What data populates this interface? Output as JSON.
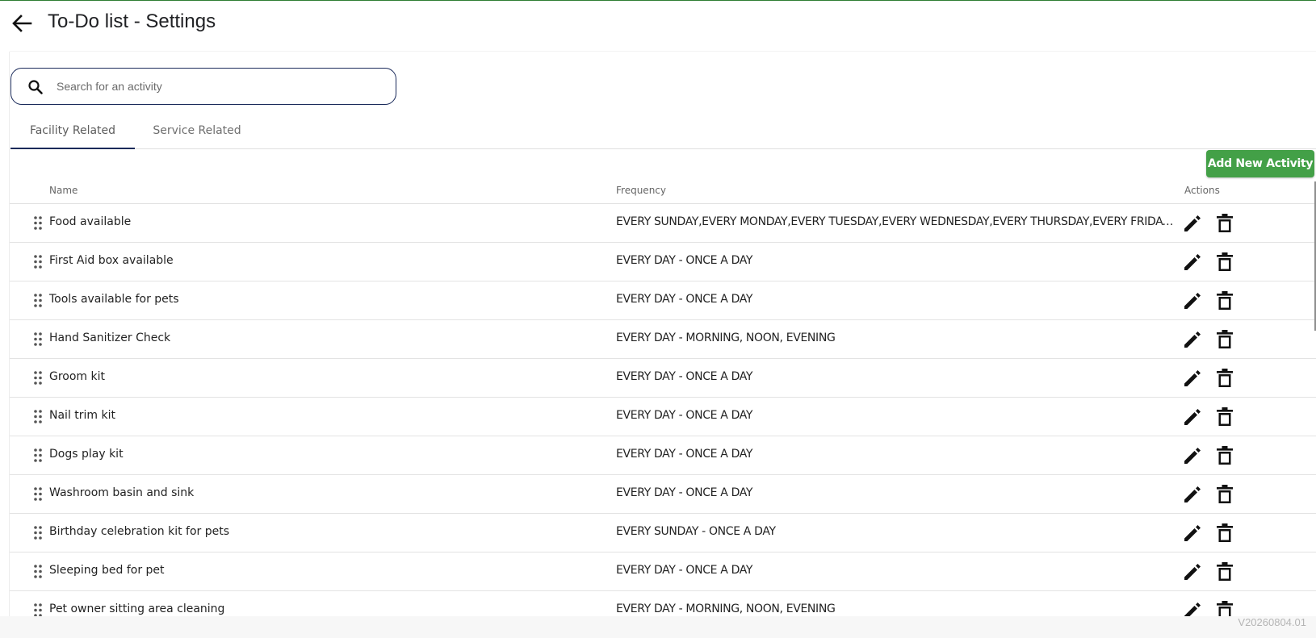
{
  "header": {
    "title": "To-Do list - Settings"
  },
  "search": {
    "placeholder": "Search for an activity",
    "value": ""
  },
  "tabs": [
    {
      "label": "Facility Related",
      "active": true
    },
    {
      "label": "Service Related",
      "active": false
    }
  ],
  "toolbar": {
    "add_label": "Add New Activity"
  },
  "table": {
    "columns": [
      "Name",
      "Frequency",
      "Actions"
    ],
    "rows": [
      {
        "name": "Food available",
        "frequency": "EVERY SUNDAY,EVERY MONDAY,EVERY TUESDAY,EVERY WEDNESDAY,EVERY THURSDAY,EVERY FRIDAY,..."
      },
      {
        "name": "First Aid box available",
        "frequency": "EVERY DAY - ONCE A DAY"
      },
      {
        "name": "Tools available for pets",
        "frequency": "EVERY DAY - ONCE A DAY"
      },
      {
        "name": "Hand Sanitizer Check",
        "frequency": "EVERY DAY - MORNING, NOON, EVENING"
      },
      {
        "name": "Groom kit",
        "frequency": "EVERY DAY - ONCE A DAY"
      },
      {
        "name": "Nail trim kit",
        "frequency": "EVERY DAY - ONCE A DAY"
      },
      {
        "name": "Dogs play kit",
        "frequency": "EVERY DAY - ONCE A DAY"
      },
      {
        "name": "Washroom basin and sink",
        "frequency": "EVERY DAY - ONCE A DAY"
      },
      {
        "name": "Birthday celebration kit for pets",
        "frequency": "EVERY SUNDAY - ONCE A DAY"
      },
      {
        "name": "Sleeping bed for pet",
        "frequency": "EVERY DAY - ONCE A DAY"
      },
      {
        "name": "Pet owner sitting area cleaning",
        "frequency": "EVERY DAY - MORNING, NOON, EVENING"
      }
    ]
  },
  "footer": {
    "version": "V20260804.01"
  },
  "icons": {
    "back": "arrow-back-icon",
    "search": "search-icon",
    "drag": "drag-handle-icon",
    "edit": "pencil-icon",
    "delete": "trash-icon"
  },
  "colors": {
    "accent_green": "#43a047",
    "top_line": "#2e7d32",
    "search_border": "#1a2a5a",
    "tab_indicator": "#1a2a5a"
  }
}
